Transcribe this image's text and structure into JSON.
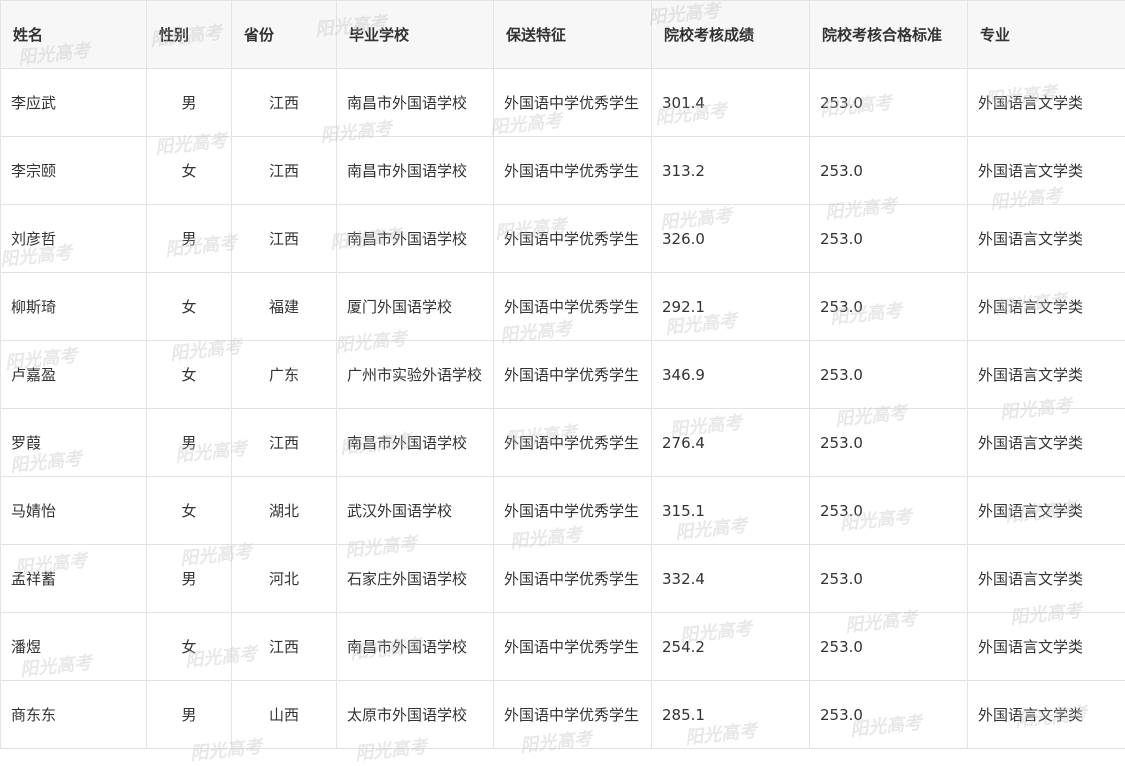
{
  "headers": {
    "name": "姓名",
    "gender": "性别",
    "province": "省份",
    "school": "毕业学校",
    "feature": "保送特征",
    "score": "院校考核成绩",
    "standard": "院校考核合格标准",
    "major": "专业"
  },
  "rows": [
    {
      "name": "李应武",
      "gender": "男",
      "province": "江西",
      "school": "南昌市外国语学校",
      "feature": "外国语中学优秀学生",
      "score": "301.4",
      "standard": "253.0",
      "major": "外国语言文学类"
    },
    {
      "name": "李宗颐",
      "gender": "女",
      "province": "江西",
      "school": "南昌市外国语学校",
      "feature": "外国语中学优秀学生",
      "score": "313.2",
      "standard": "253.0",
      "major": "外国语言文学类"
    },
    {
      "name": "刘彦哲",
      "gender": "男",
      "province": "江西",
      "school": "南昌市外国语学校",
      "feature": "外国语中学优秀学生",
      "score": "326.0",
      "standard": "253.0",
      "major": "外国语言文学类"
    },
    {
      "name": "柳斯琦",
      "gender": "女",
      "province": "福建",
      "school": "厦门外国语学校",
      "feature": "外国语中学优秀学生",
      "score": "292.1",
      "standard": "253.0",
      "major": "外国语言文学类"
    },
    {
      "name": "卢嘉盈",
      "gender": "女",
      "province": "广东",
      "school": "广州市实验外语学校",
      "feature": "外国语中学优秀学生",
      "score": "346.9",
      "standard": "253.0",
      "major": "外国语言文学类"
    },
    {
      "name": "罗葭",
      "gender": "男",
      "province": "江西",
      "school": "南昌市外国语学校",
      "feature": "外国语中学优秀学生",
      "score": "276.4",
      "standard": "253.0",
      "major": "外国语言文学类"
    },
    {
      "name": "马婧怡",
      "gender": "女",
      "province": "湖北",
      "school": "武汉外国语学校",
      "feature": "外国语中学优秀学生",
      "score": "315.1",
      "standard": "253.0",
      "major": "外国语言文学类"
    },
    {
      "name": "孟祥蓄",
      "gender": "男",
      "province": "河北",
      "school": "石家庄外国语学校",
      "feature": "外国语中学优秀学生",
      "score": "332.4",
      "standard": "253.0",
      "major": "外国语言文学类"
    },
    {
      "name": "潘煜",
      "gender": "女",
      "province": "江西",
      "school": "南昌市外国语学校",
      "feature": "外国语中学优秀学生",
      "score": "254.2",
      "standard": "253.0",
      "major": "外国语言文学类"
    },
    {
      "name": "商东东",
      "gender": "男",
      "province": "山西",
      "school": "太原市外国语学校",
      "feature": "外国语中学优秀学生",
      "score": "285.1",
      "standard": "253.0",
      "major": "外国语言文学类"
    }
  ],
  "watermark": {
    "text": "阳光高考"
  }
}
